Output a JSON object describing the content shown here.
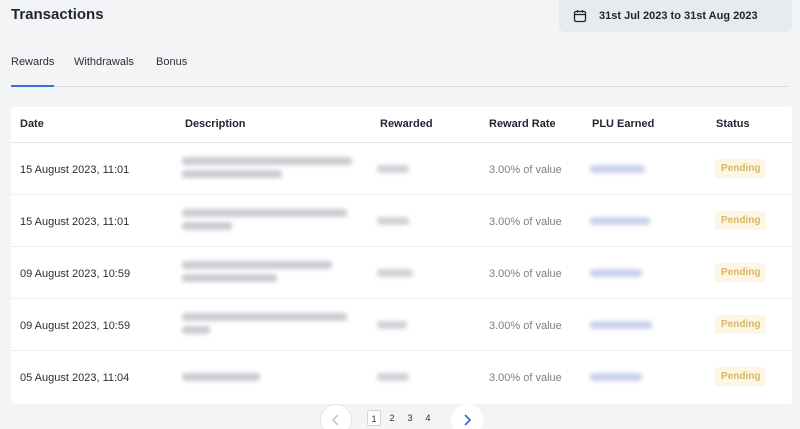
{
  "page": {
    "title": "Transactions",
    "date_range": "31st Jul 2023 to 31st Aug 2023"
  },
  "tabs": [
    {
      "label": "Rewards",
      "active": true
    },
    {
      "label": "Withdrawals",
      "active": false
    },
    {
      "label": "Bonus",
      "active": false
    }
  ],
  "table": {
    "columns": [
      "Date",
      "Description",
      "Rewarded",
      "Reward Rate",
      "PLU Earned",
      "Status"
    ],
    "rows": [
      {
        "date": "15 August 2023, 11:01",
        "rate": "3.00% of value",
        "status": "Pending"
      },
      {
        "date": "15 August 2023, 11:01",
        "rate": "3.00% of value",
        "status": "Pending"
      },
      {
        "date": "09 August 2023, 10:59",
        "rate": "3.00% of value",
        "status": "Pending"
      },
      {
        "date": "09 August 2023, 10:59",
        "rate": "3.00% of value",
        "status": "Pending"
      },
      {
        "date": "05 August 2023, 11:04",
        "rate": "3.00% of value",
        "status": "Pending"
      }
    ]
  },
  "pagination": {
    "pages": [
      "1",
      "2",
      "3",
      "4"
    ],
    "current": "1"
  },
  "colors": {
    "accent": "#3a6fd8",
    "pending_text": "#d8b866",
    "pending_bg": "#fdf6e4"
  }
}
